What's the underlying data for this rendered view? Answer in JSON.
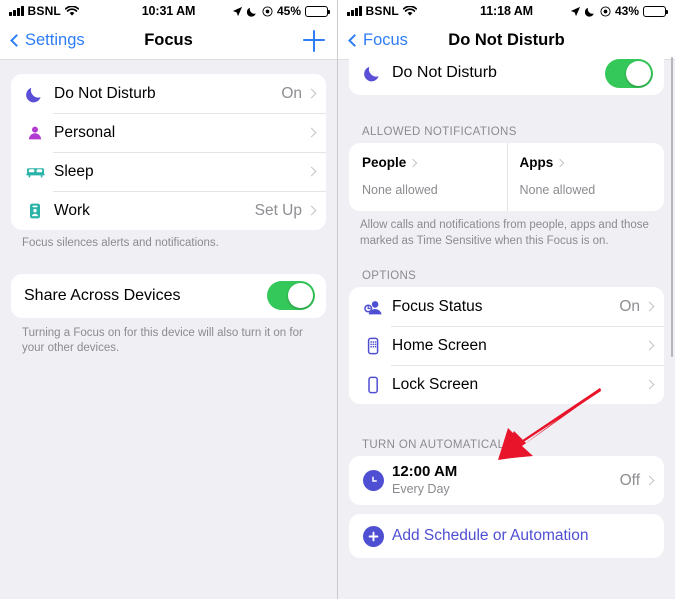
{
  "left": {
    "statusbar": {
      "carrier": "BSNL",
      "wifi_icon": "wifi-icon",
      "time": "10:31 AM",
      "location_icon": "location-arrow-icon",
      "moon_icon": "moon-icon",
      "alarm_icon": "target-icon",
      "battery_percent": "45%"
    },
    "nav": {
      "back_label": "Settings",
      "title": "Focus",
      "add_label": "add-icon"
    },
    "focus_list": [
      {
        "icon": "moon-icon",
        "icon_color": "#5a4fd6",
        "label": "Do Not Disturb",
        "value": "On"
      },
      {
        "icon": "person-icon",
        "icon_color": "#b13ad1",
        "label": "Personal",
        "value": ""
      },
      {
        "icon": "bed-icon",
        "icon_color": "#2ab3a8",
        "label": "Sleep",
        "value": ""
      },
      {
        "icon": "badge-icon",
        "icon_color": "#2ab3a8",
        "label": "Work",
        "value": "Set Up"
      }
    ],
    "focus_footnote": "Focus silences alerts and notifications.",
    "share": {
      "label": "Share Across Devices",
      "toggle_on": true,
      "footnote": "Turning a Focus on for this device will also turn it on for your other devices."
    }
  },
  "right": {
    "statusbar": {
      "carrier": "BSNL",
      "wifi_icon": "wifi-icon",
      "time": "11:18 AM",
      "location_icon": "location-arrow-icon",
      "moon_icon": "moon-icon",
      "alarm_icon": "target-icon",
      "battery_percent": "43%"
    },
    "nav": {
      "back_label": "Focus",
      "title": "Do Not Disturb"
    },
    "dnd": {
      "icon": "moon-icon",
      "label": "Do Not Disturb",
      "toggle_on": true
    },
    "allowed": {
      "header": "ALLOWED NOTIFICATIONS",
      "people": {
        "title": "People",
        "sub": "None allowed"
      },
      "apps": {
        "title": "Apps",
        "sub": "None allowed"
      },
      "footnote": "Allow calls and notifications from people, apps and those marked as Time Sensitive when this Focus is on."
    },
    "options": {
      "header": "OPTIONS",
      "items": [
        {
          "icon": "focus-status-icon",
          "label": "Focus Status",
          "value": "On"
        },
        {
          "icon": "home-screen-icon",
          "label": "Home Screen",
          "value": ""
        },
        {
          "icon": "lock-screen-icon",
          "label": "Lock Screen",
          "value": ""
        }
      ]
    },
    "automatically": {
      "header": "TURN ON AUTOMATICALLY",
      "schedule": {
        "icon": "clock-icon",
        "time": "12:00 AM",
        "repeat": "Every Day",
        "value": "Off"
      },
      "add": {
        "icon": "plus-circle-icon",
        "label": "Add Schedule or Automation"
      }
    }
  },
  "annotation": {
    "arrow_color": "#e8142a",
    "arrow_name": "red-arrow-annotation"
  },
  "colors": {
    "accent_blue": "#2e7df6",
    "indigo": "#4f4fd3",
    "green": "#34c759",
    "background": "#f0eff4"
  }
}
